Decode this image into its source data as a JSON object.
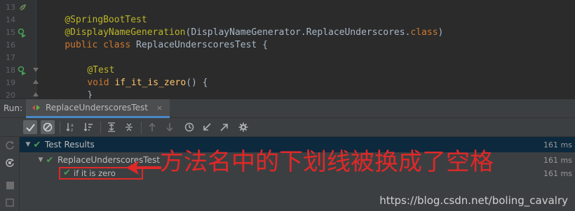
{
  "editor": {
    "line_numbers": [
      "13",
      "14",
      "15",
      "16",
      "17",
      "18",
      "19",
      "20"
    ],
    "lines": [
      {
        "annotation": "@SpringBootTest"
      },
      {
        "annotation": "@DisplayNameGeneration",
        "plain": "(DisplayNameGenerator.ReplaceUnderscores.",
        "keyword": "class",
        "tail": ")"
      },
      {
        "keyword": "public class",
        "plain": " ReplaceUnderscoresTest {"
      },
      {},
      {
        "annotation": "@Test"
      },
      {
        "keyword": "void",
        "fn": "if_it_is_zero",
        "plain": "() {"
      },
      {
        "plain": "}"
      },
      {
        "plain": "}"
      }
    ]
  },
  "run": {
    "label": "Run:",
    "tab_label": "ReplaceUnderscoresTest",
    "tab_close": "×"
  },
  "tree": {
    "root": {
      "label": "Test Results",
      "duration": "161 ms"
    },
    "class_node": {
      "label": "ReplaceUnderscoresTest",
      "duration": "161 ms"
    },
    "method_node": {
      "label": "if it is zero",
      "duration": "161 ms"
    }
  },
  "annotation_text": "方法名中的下划线被换成了空格",
  "watermark": "https://blog.csdn.net/boling_cavalry",
  "colors": {
    "editor_bg": "#2b2b2b",
    "panel_bg": "#3c3f41",
    "annotation": "#bbb529",
    "keyword": "#cc7832",
    "function": "#ffc66d",
    "pass_green": "#499c54",
    "callout_red": "#e02828"
  }
}
